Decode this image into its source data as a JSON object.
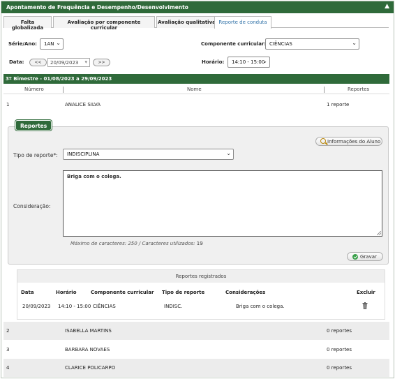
{
  "header": {
    "title": "Apontamento de Frequência e Desempenho/Desenvolvimento",
    "collapse_icon": "caret-up-icon"
  },
  "tabs": [
    {
      "label": "Falta globalizada",
      "active": false
    },
    {
      "label": "Avaliação por componente curricular",
      "active": false
    },
    {
      "label": "Avaliação qualitativa",
      "active": false
    },
    {
      "label": "Reporte de conduta",
      "active": true
    }
  ],
  "filters": {
    "serie_label": "Série/Ano:",
    "serie_value": "1AN",
    "componente_label": "Componente curricular:",
    "componente_value": "CIÊNCIAS",
    "data_label": "Data:",
    "prev_label": "<<",
    "date_value": "20/09/2023",
    "next_label": ">>",
    "horario_label": "Horário:",
    "horario_value": "14:10 - 15:00"
  },
  "period": {
    "title": "3º Bimestre - 01/08/2023 a 29/09/2023"
  },
  "table": {
    "headers": {
      "numero": "Número",
      "nome": "Nome",
      "reportes": "Reportes"
    },
    "students": [
      {
        "numero": "1",
        "nome": "ANALICE SILVA",
        "reportes": "1 reporte"
      },
      {
        "numero": "2",
        "nome": "ISABELLA MARTINS",
        "reportes": "0 reportes"
      },
      {
        "numero": "3",
        "nome": "BARBARA NOVAES",
        "reportes": "0 reportes"
      },
      {
        "numero": "4",
        "nome": "CLARICE POLICARPO",
        "reportes": "0 reportes"
      }
    ]
  },
  "report_form": {
    "legend": "Reportes",
    "info_button": "Informações do Aluno",
    "tipo_label": "Tipo de reporte*:",
    "tipo_value": "INDISCIPLINA",
    "consideracao_label": "Consideração:",
    "consideracao_value": "Briga com o colega.",
    "char_prefix": "Máximo de caracteres: 250 / Caracteres utilizados:",
    "char_used": "19",
    "save_button": "Gravar"
  },
  "registered": {
    "title": "Reportes registrados",
    "columns": {
      "data": "Data",
      "horario": "Horário",
      "componente": "Componente curricular",
      "tipo": "Tipo de reporte",
      "consideracoes": "Considerações",
      "excluir": "Excluir"
    },
    "row": {
      "data": "20/09/2023",
      "horario": "14:10 - 15:00",
      "componente": "CIÊNCIAS",
      "tipo": "INDISC.",
      "consideracoes": "Briga com o colega."
    }
  }
}
